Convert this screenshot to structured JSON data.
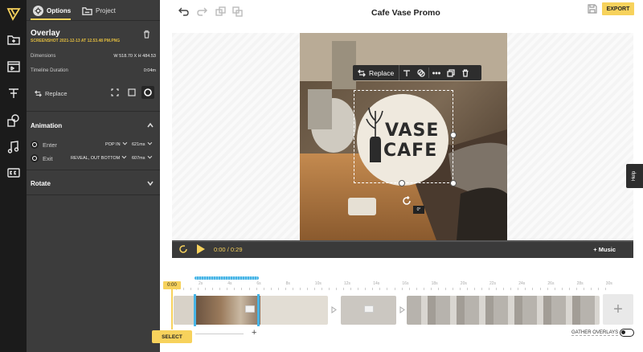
{
  "rail": {
    "items": [
      "logo-icon",
      "media-icon",
      "templates-icon",
      "text-icon",
      "elements-icon",
      "music-icon",
      "subtitles-icon"
    ]
  },
  "panel": {
    "tabs": [
      {
        "label": "Options",
        "active": true
      },
      {
        "label": "Project",
        "active": false
      }
    ],
    "overlay_title": "Overlay",
    "overlay_file": "SCREENSHOT 2021-12-13 AT 12.53.48 PM.PNG",
    "dimensions_label": "Dimensions",
    "dimensions_value": "W 518.70  X  H 484.53",
    "timeline_duration_label": "Timeline Duration",
    "timeline_duration_value": "0:04m",
    "replace_label": "Replace",
    "animation": {
      "title": "Animation",
      "enter_label": "Enter",
      "enter_type": "POP IN",
      "enter_duration": "621ms",
      "exit_label": "Exit",
      "exit_type": "REVEAL, OUT BOTTOM",
      "exit_duration": "607ms"
    },
    "rotate_title": "Rotate"
  },
  "topbar": {
    "project_title": "Cafe Vase Promo",
    "export_label": "EXPORT"
  },
  "canvas": {
    "logo_line1": "VASE",
    "logo_line2": "CAFE",
    "angle": "0°",
    "ctx_replace_label": "Replace"
  },
  "help_label": "Help",
  "player": {
    "current_time": "0:00",
    "separator": "/",
    "total_time": "0:29",
    "music_label": "+ Music"
  },
  "timeline": {
    "playhead_label": "0:00",
    "ticks": [
      "2s",
      "4s",
      "6s",
      "8s",
      "10s",
      "12s",
      "14s",
      "16s",
      "18s",
      "20s",
      "22s",
      "24s",
      "26s",
      "28s",
      "30s"
    ],
    "select_label": "SELECT",
    "zoom_plus": "+",
    "add_clip": "+",
    "gather_label": "GATHER OVERLAYS"
  },
  "colors": {
    "accent": "#f7d25c",
    "selection": "#46b4e6",
    "panel_bg": "#3c3c3c",
    "rail_bg": "#1b1b1b"
  }
}
